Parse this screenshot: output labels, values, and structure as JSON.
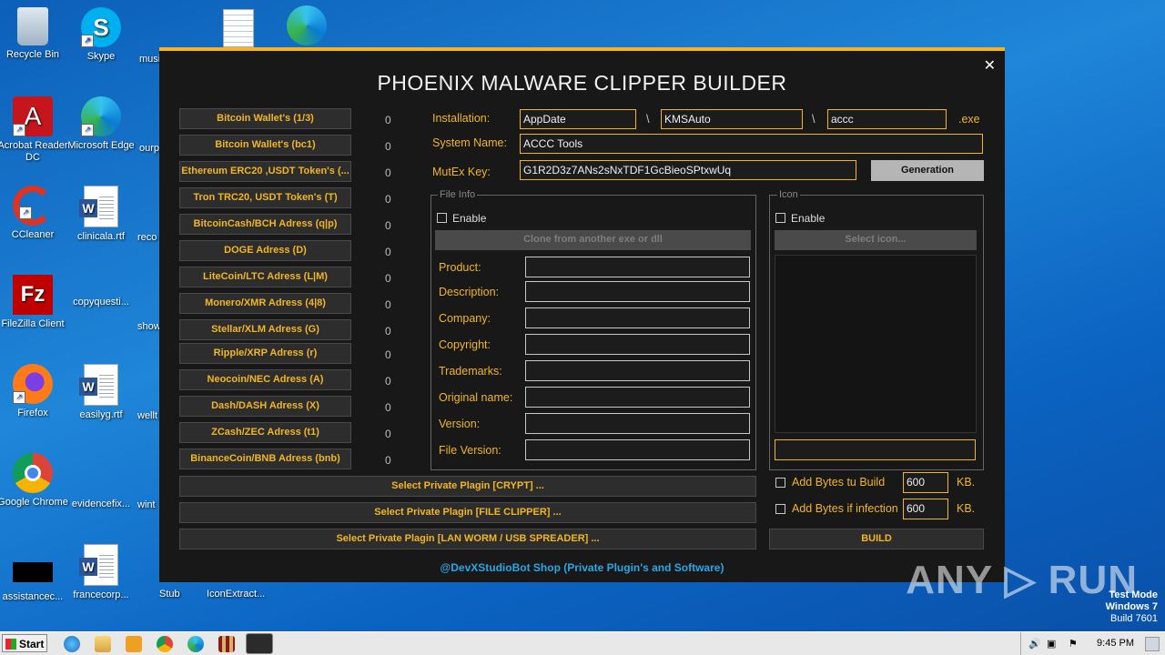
{
  "desktop": {
    "icons_col1": [
      "Recycle Bin",
      "Acrobat Reader DC",
      "CCleaner",
      "FileZilla Client",
      "Firefox",
      "Google Chrome",
      "assistancec..."
    ],
    "icons_col2": [
      "Skype",
      "Microsoft Edge",
      "clinicala.rtf",
      "copyquesti...",
      "easilyg.rtf",
      "evidencefix...",
      "francecorp..."
    ],
    "partial_labels": [
      "musi",
      "ourp",
      "reco",
      "show",
      "wellt",
      "wint",
      "Stub",
      "IconExtract..."
    ]
  },
  "app": {
    "title": "PHOENIX MALWARE CLIPPER BUILDER",
    "close_glyph": "✕",
    "wallets": [
      {
        "label": "Bitcoin Wallet's (1/3)",
        "count": "0"
      },
      {
        "label": "Bitcoin Wallet's (bc1)",
        "count": "0"
      },
      {
        "label": "Ethereum ERC20 ,USDT Token's (...",
        "count": "0"
      },
      {
        "label": "Tron TRC20, USDT Token's (T)",
        "count": "0"
      },
      {
        "label": "BitcoinCash/BCH Adress (q|p)",
        "count": "0"
      },
      {
        "label": "DOGE Adress (D)",
        "count": "0"
      },
      {
        "label": "LiteCoin/LTC Adress (L|M)",
        "count": "0"
      },
      {
        "label": "Monero/XMR Adress (4|8)",
        "count": "0"
      },
      {
        "label": "Stellar/XLM Adress (G)",
        "count": "0"
      },
      {
        "label": "Ripple/XRP Adress (r)",
        "count": "0"
      },
      {
        "label": "Neocoin/NEC Adress (A)",
        "count": "0"
      },
      {
        "label": "Dash/DASH Adress (X)",
        "count": "0"
      },
      {
        "label": "ZCash/ZEC Adress (t1)",
        "count": "0"
      },
      {
        "label": "BinanceCoin/BNB Adress (bnb)",
        "count": "0"
      }
    ],
    "installation": {
      "label": "Installation:",
      "folder1": "AppDate",
      "sep": "\\",
      "folder2": "KMSAuto",
      "filename": "accc",
      "ext": ".exe"
    },
    "system_name": {
      "label": "System Name:",
      "value": "ACCC Tools"
    },
    "mutex": {
      "label": "MutEx Key:",
      "value": "G1R2D3z7ANs2sNxTDF1GcBieoSPtxwUq",
      "button": "Generation"
    },
    "file_info": {
      "group_title": "File Info",
      "enable_label": "Enable",
      "clone_button": "Clone from another exe or dll",
      "fields": [
        "Product:",
        "Description:",
        "Company:",
        "Copyright:",
        "Trademarks:",
        "Original name:",
        "Version:",
        "File Version:"
      ]
    },
    "icon_group": {
      "group_title": "Icon",
      "enable_label": "Enable",
      "select_button": "Select icon..."
    },
    "plugins": [
      "Select Private Plagin [CRYPT] ...",
      "Select Private Plagin [FILE CLIPPER] ...",
      "Select Private Plagin [LAN WORM / USB SPREADER] ..."
    ],
    "add_bytes_build": {
      "label": "Add Bytes tu Build",
      "value": "600",
      "unit": "KB."
    },
    "add_bytes_infection": {
      "label": "Add Bytes if infection",
      "value": "600",
      "unit": "KB."
    },
    "build_button": "BUILD",
    "footer": "@DevXStudioBot Shop (Private Plugin's and Software)"
  },
  "watermark": {
    "text": "ANY ▷ RUN"
  },
  "os_info": {
    "line1": "Test Mode",
    "line2": "Windows 7",
    "line3": "Build 7601"
  },
  "taskbar": {
    "start_label": "Start",
    "clock": "9:45 PM"
  }
}
